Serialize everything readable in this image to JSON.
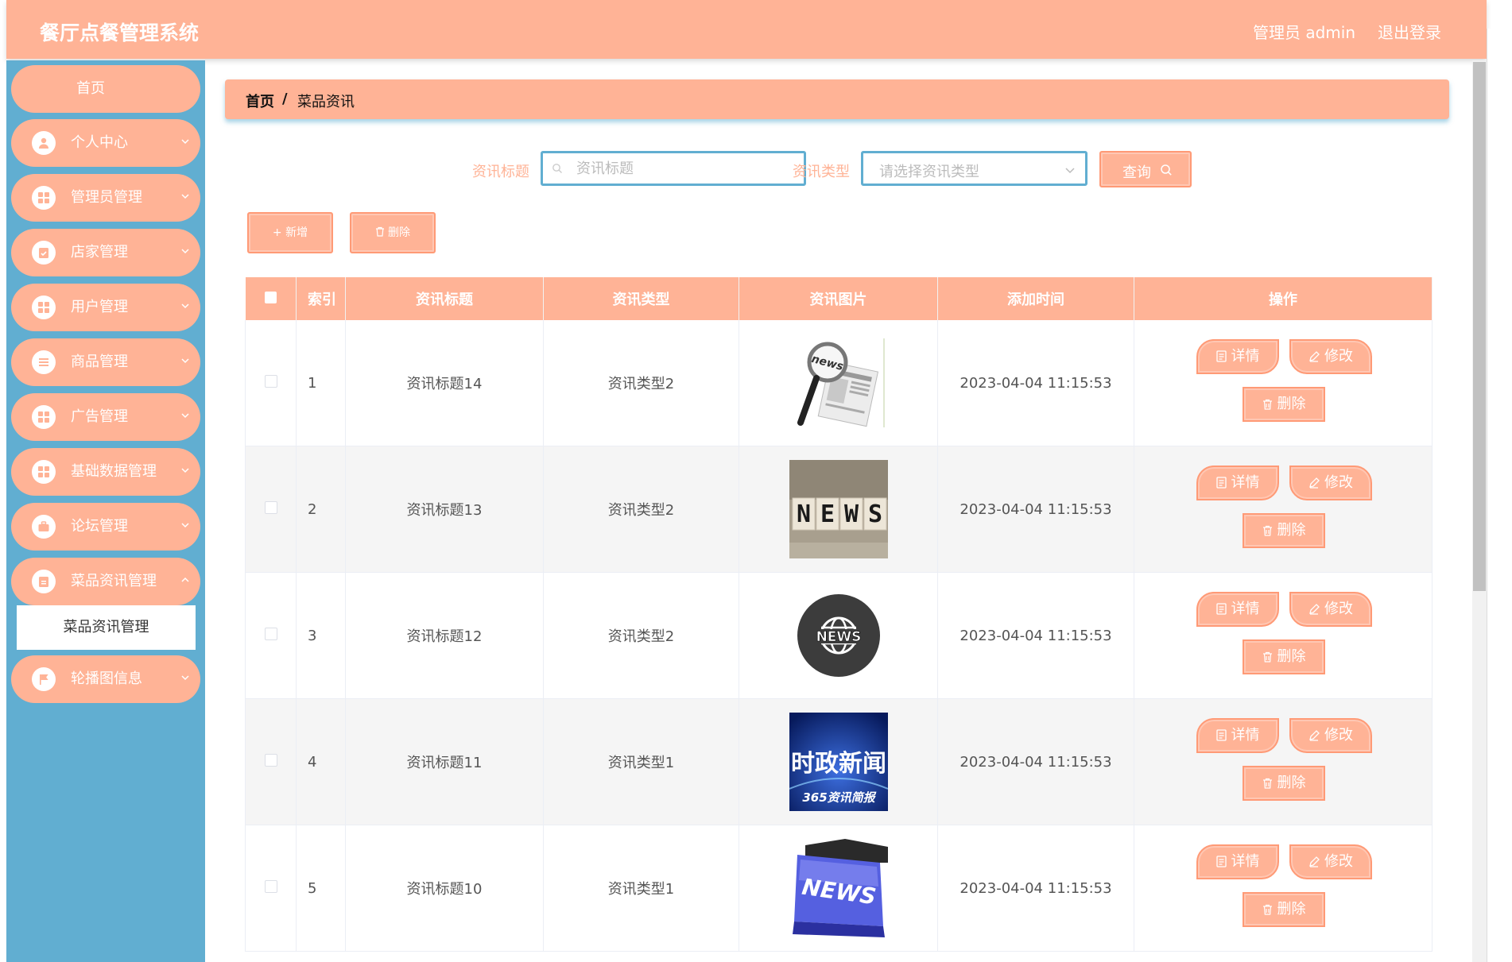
{
  "header": {
    "title": "餐厅点餐管理系统",
    "admin": "管理员 admin",
    "logout": "退出登录"
  },
  "sidebar": {
    "home": "首页",
    "items": [
      {
        "label": "个人中心"
      },
      {
        "label": "管理员管理"
      },
      {
        "label": "店家管理"
      },
      {
        "label": "用户管理"
      },
      {
        "label": "商品管理"
      },
      {
        "label": "广告管理"
      },
      {
        "label": "基础数据管理"
      },
      {
        "label": "论坛管理"
      },
      {
        "label": "菜品资讯管理"
      },
      {
        "label": "轮播图信息"
      }
    ],
    "submenu": "菜品资讯管理"
  },
  "breadcrumb": {
    "home": "首页",
    "separator": "/",
    "current": "菜品资讯"
  },
  "search": {
    "title_label": "资讯标题",
    "title_placeholder": "资讯标题",
    "type_label": "资讯类型",
    "type_placeholder": "请选择资讯类型",
    "query_button": "查询"
  },
  "toolbar": {
    "add": "+ 新增",
    "delete": "删除"
  },
  "table": {
    "headers": [
      "索引",
      "资讯标题",
      "资讯类型",
      "资讯图片",
      "添加时间",
      "操作"
    ],
    "rows": [
      {
        "index": "1",
        "title": "资讯标题14",
        "type": "资讯类型2",
        "image": "news-magnifier",
        "time": "2023-04-04 11:15:53"
      },
      {
        "index": "2",
        "title": "资讯标题13",
        "type": "资讯类型2",
        "image": "news-blocks",
        "time": "2023-04-04 11:15:53"
      },
      {
        "index": "3",
        "title": "资讯标题12",
        "type": "资讯类型2",
        "image": "news-globe",
        "time": "2023-04-04 11:15:53"
      },
      {
        "index": "4",
        "title": "资讯标题11",
        "type": "资讯类型1",
        "image": "news-politics",
        "time": "2023-04-04 11:15:53"
      },
      {
        "index": "5",
        "title": "资讯标题10",
        "type": "资讯类型1",
        "image": "news-key",
        "time": "2023-04-04 11:15:53"
      }
    ],
    "actions": {
      "detail": "详情",
      "edit": "修改",
      "delete": "删除"
    }
  },
  "images": {
    "news_politics_line1": "时政新闻",
    "news_politics_line2": "365资讯简报",
    "news_word": "NEWS",
    "news_lower": "news",
    "news_blocks": [
      "N",
      "E",
      "W",
      "S"
    ]
  },
  "colors": {
    "accent": "#ffb396",
    "sidebar": "#61aed1"
  }
}
